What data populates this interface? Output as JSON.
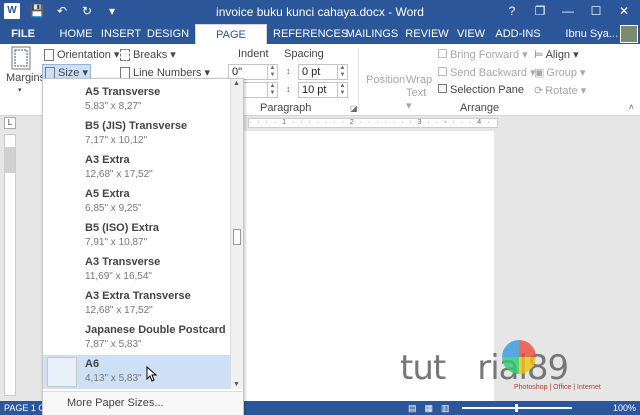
{
  "titlebar": {
    "title": "invoice buku kunci cahaya.docx - Word",
    "word_icon": "W",
    "save_icon": "💾",
    "undo_icon": "↶",
    "redo_icon": "↻",
    "qat_more_icon": "▾",
    "help": "?",
    "restore": "❐",
    "minimize": "—",
    "maximize": "☐",
    "close": "✕"
  },
  "tabs": [
    "FILE",
    "HOME",
    "INSERT",
    "DESIGN",
    "PAGE LAYOUT",
    "REFERENCES",
    "MAILINGS",
    "REVIEW",
    "VIEW",
    "ADD-INS"
  ],
  "active_tab": "PAGE LAYOUT",
  "user": "Ibnu Sya...",
  "ribbon": {
    "margins": "Margins",
    "orientation": "Orientation ▾",
    "size": "Size ▾",
    "breaks": "Breaks ▾",
    "line_numbers": "Line Numbers ▾",
    "indent_label": "Indent",
    "spacing_label": "Spacing",
    "indent_left": "0\"",
    "indent_right": "0\"",
    "spacing_before": "0 pt",
    "spacing_after": "10 pt",
    "paragraph_label": "Paragraph",
    "position": "Position",
    "wrap_text": "Wrap Text ▾",
    "bring_forward": "Bring Forward ▾",
    "send_backward": "Send Backward ▾",
    "selection_pane": "Selection Pane",
    "align": "Align ▾",
    "group": "Group ▾",
    "rotate": "Rotate ▾",
    "arrange_label": "Arrange"
  },
  "size_menu": {
    "items": [
      {
        "name": "A5 Transverse",
        "size": "5,83\" x 8,27\""
      },
      {
        "name": "B5 (JIS) Transverse",
        "size": "7,17\" x 10,12\""
      },
      {
        "name": "A3 Extra",
        "size": "12,68\" x 17,52\""
      },
      {
        "name": "A5 Extra",
        "size": "6,85\" x 9,25\""
      },
      {
        "name": "B5 (ISO) Extra",
        "size": "7,91\" x 10,87\""
      },
      {
        "name": "A3 Transverse",
        "size": "11,69\" x 16,54\""
      },
      {
        "name": "A3 Extra Transverse",
        "size": "12,68\" x 17,52\""
      },
      {
        "name": "Japanese Double Postcard",
        "size": "7,87\" x 5,83\""
      },
      {
        "name": "A6",
        "size": "4,13\" x 5,83\""
      }
    ],
    "selected_index": 8,
    "more": "More Paper Sizes..."
  },
  "statusbar": {
    "page": "PAGE 1 O",
    "zoom": "100%"
  },
  "watermark": {
    "text_left": "tut",
    "text_right": "rial89",
    "sub": "Photoshop | Office | Internet"
  }
}
